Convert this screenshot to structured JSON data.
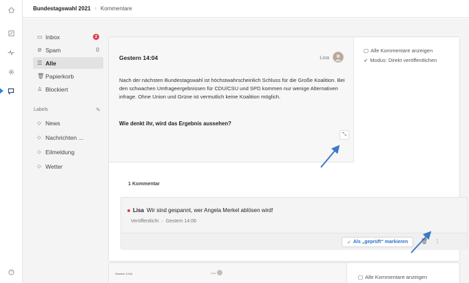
{
  "topbar": {
    "crumb1": "Bundestagswahl 2021",
    "separator": "›",
    "crumb2": "Kommentare"
  },
  "rail": {
    "icons": [
      "home-icon",
      "edit-icon",
      "activity-icon",
      "settings-icon",
      "comments-icon",
      "help-icon"
    ]
  },
  "nav": {
    "items": [
      {
        "label": "Inbox",
        "icon": "inbox-icon",
        "badge": "2"
      },
      {
        "label": "Spam",
        "icon": "spam-icon",
        "count": "0"
      },
      {
        "label": "Alle",
        "icon": "all-icon"
      },
      {
        "label": "Papierkorb",
        "icon": "trash-icon"
      },
      {
        "label": "Blockiert",
        "icon": "blocked-user-icon"
      }
    ],
    "labels_heading": "Labels",
    "labels": [
      "News",
      "Nachrichten ...",
      "Eilmeldung",
      "Wetter"
    ]
  },
  "post": {
    "date": "Gestern 14:04",
    "author": "Lisa",
    "body": "Nach der nächsten Bundestagswahl ist höchstwahrscheinlich Schluss für die Große Koalition. Bei den schwachen Umfrageergebnissen für CDU/CSU und SPD kommen nur wenige Alternativen infrage. Ohne Union und Grüne ist vermutlich keine Koalition möglich.",
    "question": "Wie denkt ihr, wird das Ergebnis aussehen?",
    "side_links": [
      "Alle Kommentare anzeigen",
      "Modus: Direkt veröffentlichen"
    ]
  },
  "comments": {
    "count_label": "1 Kommentar",
    "items": [
      {
        "author": "Lisa",
        "text": "Wir sind gespannt, wer Angela Merkel ablösen wird!",
        "status": "Veröffentlicht",
        "separator": "·",
        "time": "Gestern 14:06",
        "mark_button": "Als „geprüft“ markieren"
      }
    ]
  },
  "post2": {
    "date": "Gestern 14:04",
    "author": "Lisa",
    "side_link": "Alle Kommentare anzeigen"
  },
  "colors": {
    "accent": "#2a72c7",
    "badge": "#e5394c",
    "arrow": "#3a78c9"
  }
}
